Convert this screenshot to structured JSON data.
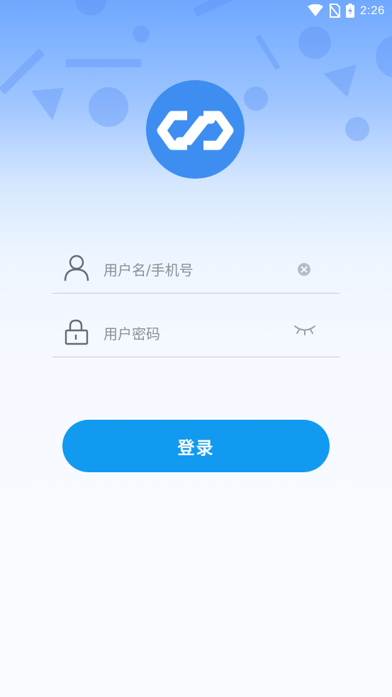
{
  "status_bar": {
    "time": "2:26",
    "icons": [
      "wifi-icon",
      "no-sim-icon",
      "battery-charging-icon"
    ]
  },
  "logo": {
    "icon": "link-hexagon-logo",
    "color": "#3d8ef0"
  },
  "login_form": {
    "username": {
      "placeholder": "用户名/手机号",
      "value": "",
      "icon": "user-icon",
      "action_icon": "clear-icon"
    },
    "password": {
      "placeholder": "用户密码",
      "value": "",
      "icon": "lock-icon",
      "action_icon": "eye-closed-icon"
    },
    "submit_label": "登录"
  },
  "colors": {
    "accent": "#119af0",
    "gradient_top": "#6fa8ff",
    "background": "#f8fbff"
  }
}
